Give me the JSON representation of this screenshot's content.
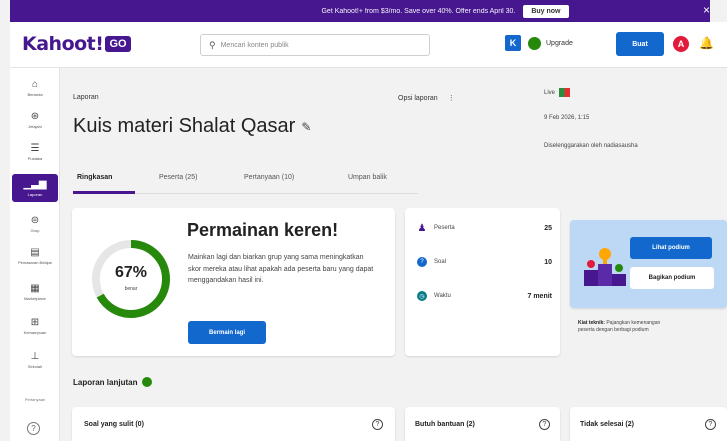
{
  "banner": {
    "text": "Get Kahoot!+ from $3/mo. Save over 40%. Offer ends April 30.",
    "button": "Buy now",
    "close": "×"
  },
  "topbar": {
    "logo_main": "Kahoot!",
    "logo_badge": "GO",
    "search_placeholder": "Mencari konten publik",
    "k_badge": "K",
    "upgrade": "Upgrade",
    "create": "Buat",
    "avatar_initial": "A",
    "bell": "🔔"
  },
  "sidebar": {
    "items": [
      {
        "label": "Beranda",
        "icon": "⌂"
      },
      {
        "label": "Jelajahi",
        "icon": "⊛"
      },
      {
        "label": "Pustaka",
        "icon": "☰"
      },
      {
        "label": "Laporan",
        "icon": "▁▃▆"
      },
      {
        "label": "Grup",
        "icon": "⊜"
      },
      {
        "label": "Pemasaran Belajar",
        "icon": "▤"
      },
      {
        "label": "Marketplace",
        "icon": "▦"
      },
      {
        "label": "Kemampuan",
        "icon": "⊞"
      },
      {
        "label": "Sekolah",
        "icon": "⊥"
      }
    ],
    "bottom_label": "Pertanyaan",
    "help": "?"
  },
  "header": {
    "breadcrumb": "Laporan",
    "options": "Opsi laporan",
    "options_icon": "⋮",
    "title": "Kuis materi Shalat Qasar",
    "edit_icon": "✎"
  },
  "meta": {
    "live": "Live",
    "date": "9 Feb 2026, 1:15",
    "host": "Diselenggarakan oleh nadiasausha"
  },
  "tabs": [
    {
      "label": "Ringkasan",
      "active": true
    },
    {
      "label": "Peserta (25)",
      "active": false
    },
    {
      "label": "Pertanyaan (10)",
      "active": false
    },
    {
      "label": "Umpan balik",
      "active": false
    }
  ],
  "summary": {
    "percent": "67%",
    "percent_value": 67,
    "percent_sub": "benar",
    "title": "Permainan keren!",
    "desc": "Mainkan lagi dan biarkan grup yang sama meningkatkan skor mereka atau lihat apakah ada peserta baru yang dapat menggandakan hasil ini.",
    "play_again": "Bermain lagi"
  },
  "stats": [
    {
      "label": "Peserta",
      "value": "25",
      "color": "#46178f",
      "icon": "♟"
    },
    {
      "label": "Soal",
      "value": "10",
      "color": "#1368ce",
      "icon": "?"
    },
    {
      "label": "Waktu",
      "value": "7 menit",
      "color": "#0a7c88",
      "icon": "◷"
    }
  ],
  "podium": {
    "view": "Lihat podium",
    "share": "Bagikan podium",
    "tip_bold": "Kiat teknik:",
    "tip": "Pajangkan kemenangan peserta dengan berbagi podium"
  },
  "advanced": {
    "label": "Laporan lanjutan"
  },
  "bottom_cards": [
    {
      "title": "Soal yang sulit (0)",
      "help": "?"
    },
    {
      "title": "Butuh bantuan (2)",
      "help": "?"
    },
    {
      "title": "Tidak selesai (2)",
      "help": "?"
    }
  ],
  "colors": {
    "brand": "#46178f",
    "primary": "#1368ce",
    "success": "#26890c",
    "danger": "#e21b3c"
  }
}
